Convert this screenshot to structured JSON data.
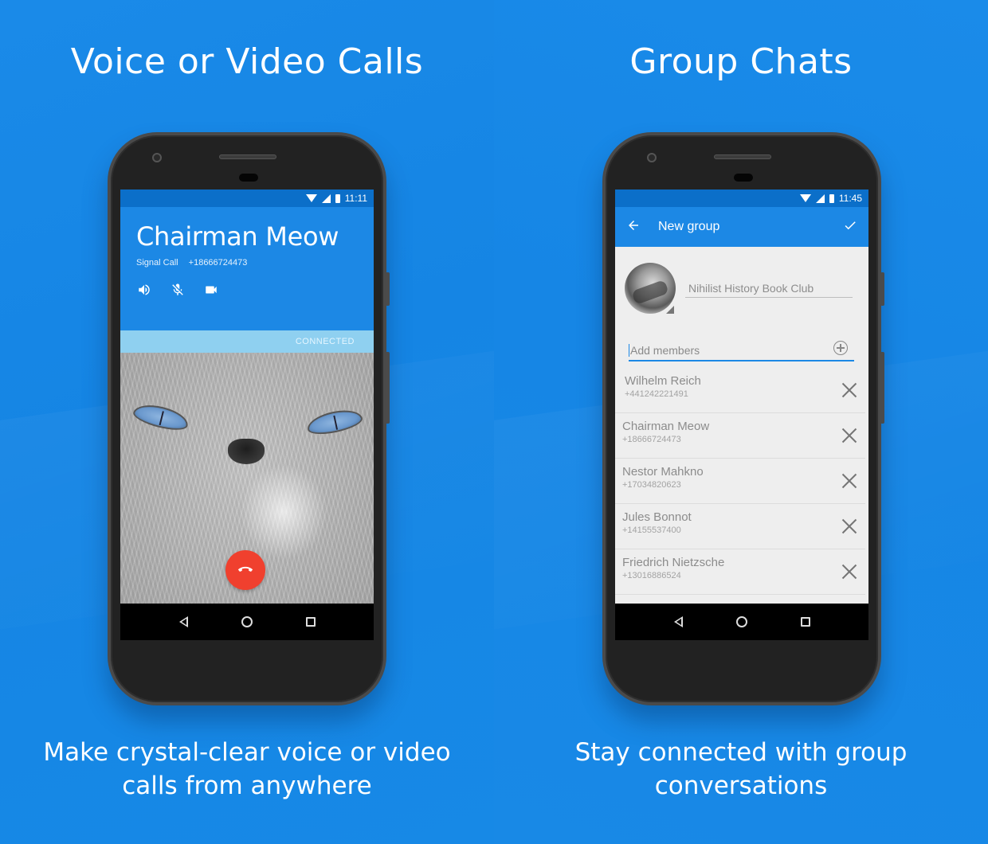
{
  "left_panel": {
    "headline": "Voice or Video Calls",
    "caption_line1": "Make crystal-clear voice or video",
    "caption_line2": "calls from anywhere",
    "phone": {
      "status_time": "11:11",
      "contact_name": "Chairman Meow",
      "call_type": "Signal Call",
      "call_number": "+18666724473",
      "call_actions": [
        {
          "icon": "speaker-icon",
          "label": "Speaker"
        },
        {
          "icon": "mic-off-icon",
          "label": "Mute"
        },
        {
          "icon": "video-camera-icon",
          "label": "Video"
        }
      ],
      "call_status": "CONNECTED",
      "hangup_icon": "end-call-icon"
    }
  },
  "right_panel": {
    "headline": "Group Chats",
    "caption_line1": "Stay connected with group",
    "caption_line2": "conversations",
    "phone": {
      "status_time": "11:45",
      "toolbar_title": "New group",
      "group_name_value": "Nihilist History Book Club",
      "add_members_placeholder": "Add members",
      "members": [
        {
          "name": "Wilhelm Reich",
          "phone": "+441242221491"
        },
        {
          "name": "Chairman Meow",
          "phone": "+18666724473"
        },
        {
          "name": "Nestor Mahkno",
          "phone": "+17034820623"
        },
        {
          "name": "Jules Bonnot",
          "phone": "+14155537400"
        },
        {
          "name": "Friedrich Nietzsche",
          "phone": "+13016886524"
        }
      ]
    }
  },
  "colors": {
    "background": "#1688e6",
    "app_primary": "#1c88e5",
    "status_bar": "#0b6fc9",
    "connected_bar": "#8fd0f0",
    "hangup": "#f0402e"
  }
}
